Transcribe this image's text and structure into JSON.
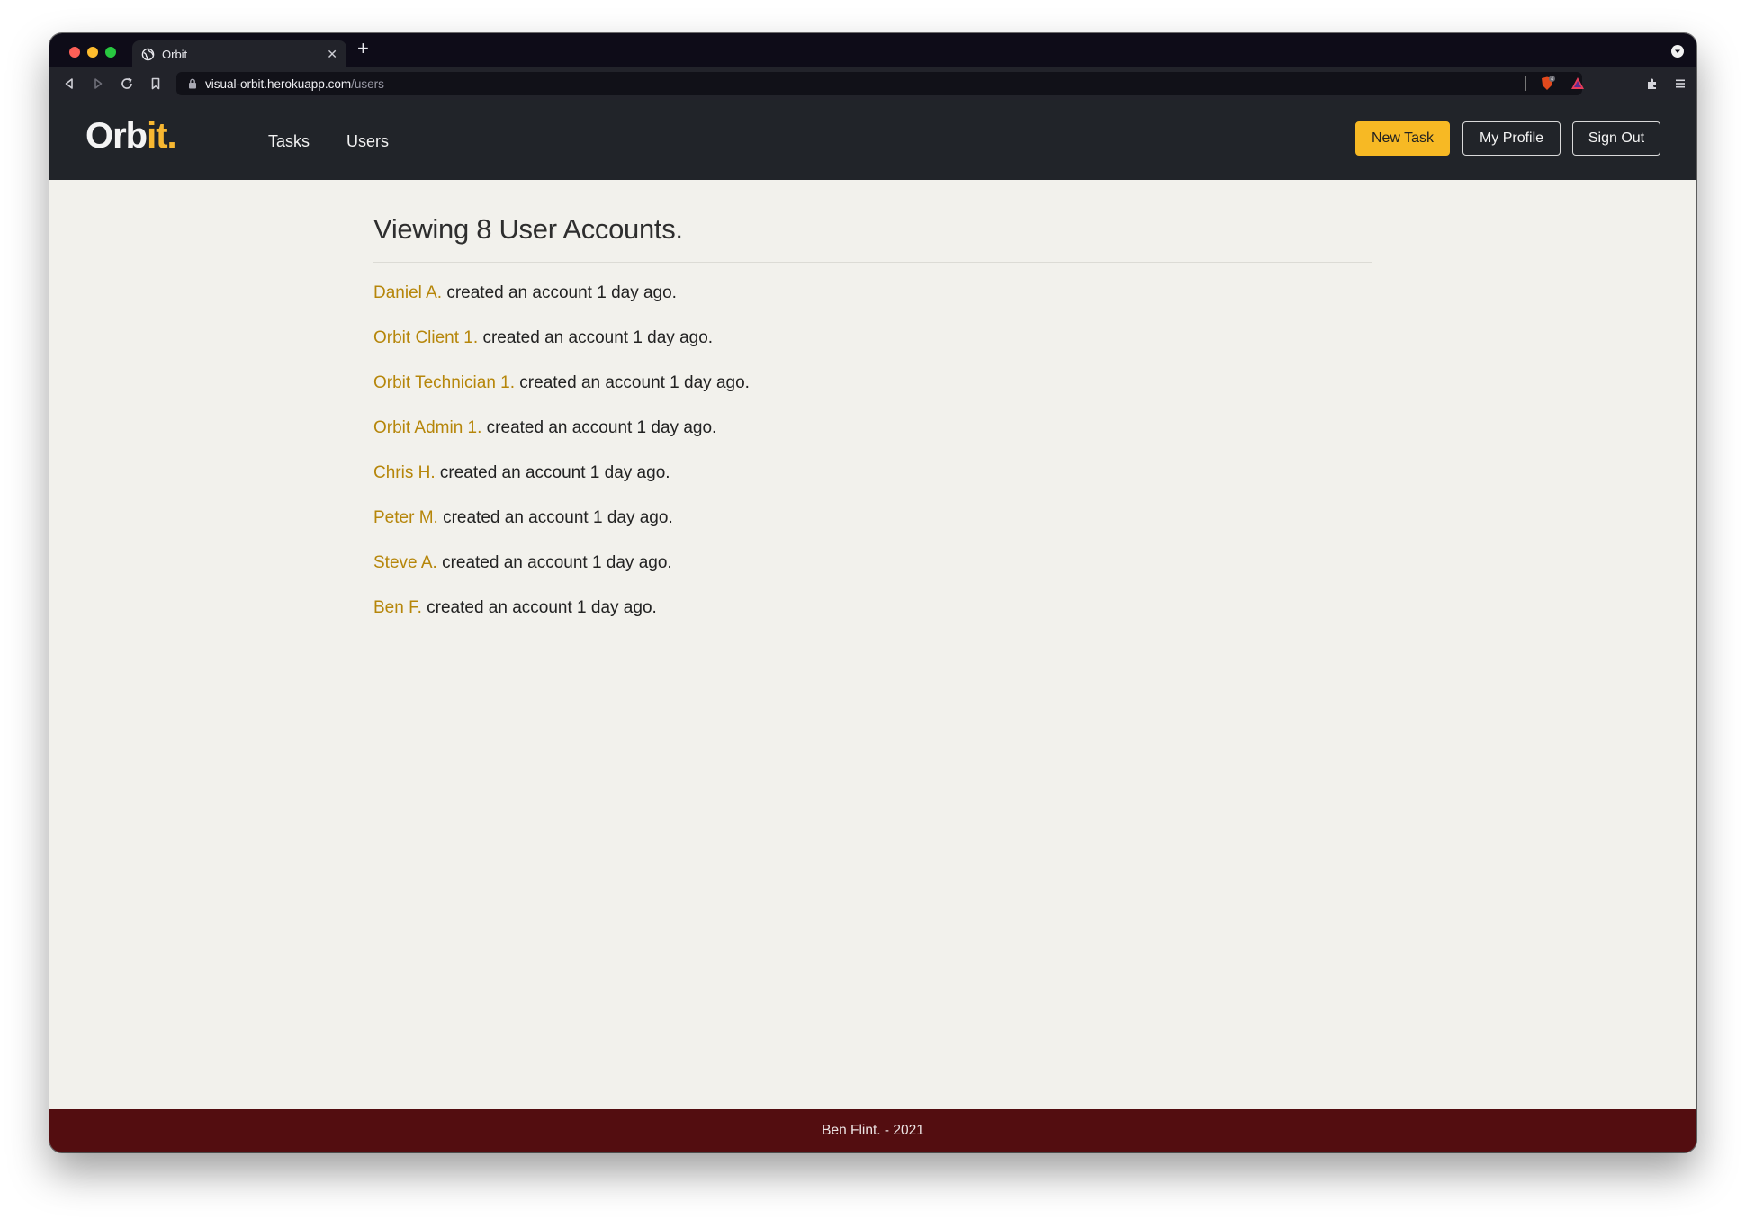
{
  "browser": {
    "tab_title": "Orbit",
    "url_host": "visual-orbit.herokuapp.com",
    "url_path": "/users",
    "extension_badge": "4"
  },
  "nav": {
    "brand_main": "Orb",
    "brand_accent": "it.",
    "links": [
      "Tasks",
      "Users"
    ],
    "buttons": {
      "new_task": "New Task",
      "my_profile": "My Profile",
      "sign_out": "Sign Out"
    }
  },
  "main": {
    "title": "Viewing 8 User Accounts.",
    "users": [
      {
        "name": "Daniel A.",
        "text": "created an account 1 day ago."
      },
      {
        "name": "Orbit Client 1.",
        "text": "created an account 1 day ago."
      },
      {
        "name": "Orbit Technician 1.",
        "text": "created an account 1 day ago."
      },
      {
        "name": "Orbit Admin 1.",
        "text": "created an account 1 day ago."
      },
      {
        "name": "Chris H.",
        "text": "created an account 1 day ago."
      },
      {
        "name": "Peter M.",
        "text": "created an account 1 day ago."
      },
      {
        "name": "Steve A.",
        "text": "created an account 1 day ago."
      },
      {
        "name": "Ben F.",
        "text": "created an account 1 day ago."
      }
    ]
  },
  "footer": {
    "text": "Ben Flint. - 2021"
  },
  "colors": {
    "accent": "#f7b924",
    "link": "#b6860a",
    "nav_bg": "#212429",
    "footer_bg": "#530d10",
    "page_bg": "#f2f1ec"
  }
}
